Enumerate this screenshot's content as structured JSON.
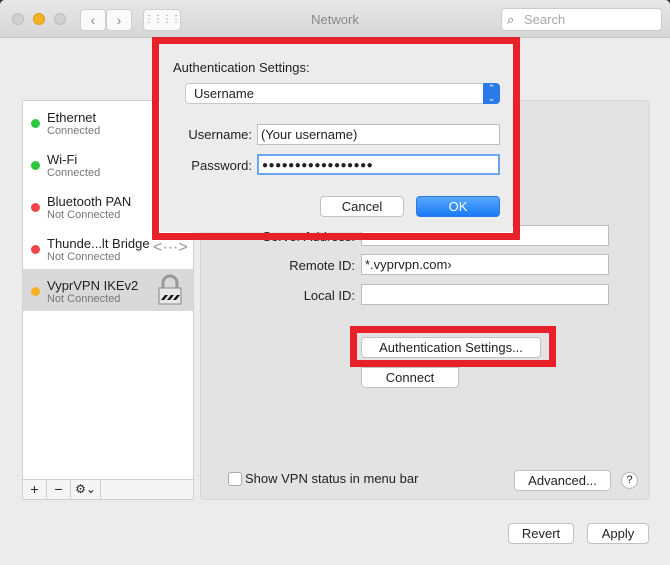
{
  "window": {
    "title": "Network",
    "search_placeholder": "Search"
  },
  "sidebar": {
    "items": [
      {
        "name": "Ethernet",
        "status": "Connected",
        "color": "#2fc640",
        "icon": ""
      },
      {
        "name": "Wi-Fi",
        "status": "Connected",
        "color": "#2fc640",
        "icon": ""
      },
      {
        "name": "Bluetooth PAN",
        "status": "Not Connected",
        "color": "#f0464a",
        "icon": ""
      },
      {
        "name": "Thunde...lt Bridge",
        "status": "Not Connected",
        "color": "#f0464a",
        "icon": "<···>"
      },
      {
        "name": "VyprVPN IKEv2",
        "status": "Not Connected",
        "color": "#f5b324",
        "icon": "lock-icon"
      }
    ],
    "add": "+",
    "remove": "−",
    "gear": "⚙⌄"
  },
  "panel": {
    "server_address_label": "Server Address:",
    "remote_id_label": "Remote ID:",
    "remote_id_value": "*.vyprvpn.com›",
    "local_id_label": "Local ID:",
    "local_id_value": "",
    "auth_button": "Authentication Settings...",
    "connect_button": "Connect",
    "show_vpn_status": "Show VPN status in menu bar",
    "advanced_button": "Advanced...",
    "help": "?"
  },
  "footer": {
    "revert": "Revert",
    "apply": "Apply"
  },
  "dialog": {
    "heading": "Authentication Settings:",
    "method": "Username",
    "username_label": "Username:",
    "username_value": "(Your username)",
    "password_label": "Password:",
    "password_value": "●●●●●●●●●●●●●●●●●",
    "cancel": "Cancel",
    "ok": "OK"
  },
  "colors": {
    "highlight": "#e8202a",
    "accent": "#1a7bf5"
  }
}
